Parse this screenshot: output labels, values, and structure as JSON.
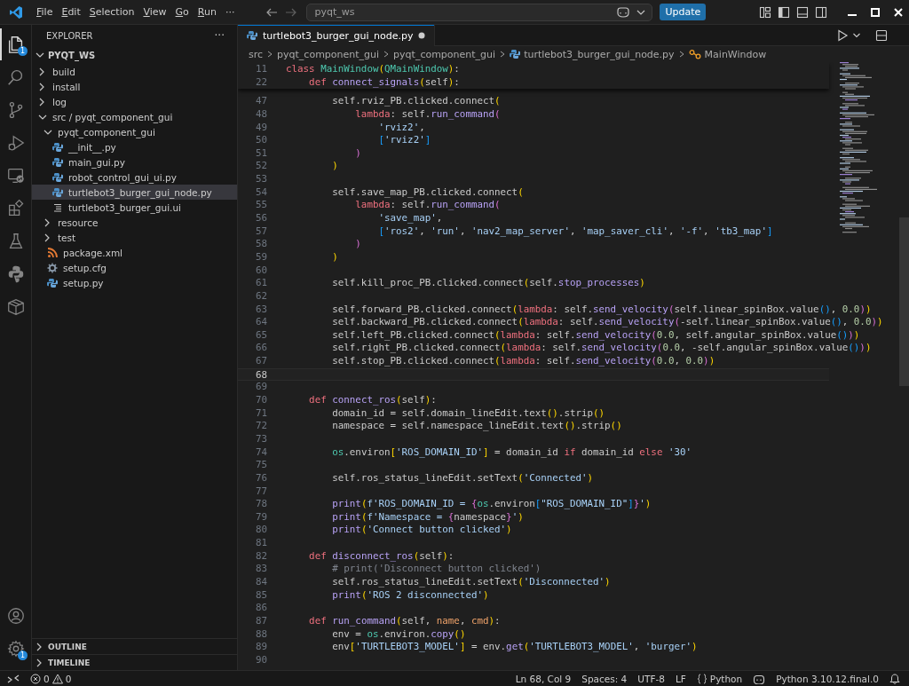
{
  "title_bar": {
    "menus": [
      "File",
      "Edit",
      "Selection",
      "View",
      "Go",
      "Run"
    ],
    "more": "···",
    "search": {
      "value": "pyqt_ws"
    },
    "update_button": "Update"
  },
  "activity_bar": {
    "items": [
      {
        "kind": "explorer",
        "selected": true,
        "badge": "1"
      },
      {
        "kind": "search",
        "selected": false
      },
      {
        "kind": "source-control",
        "selected": false
      },
      {
        "kind": "debug",
        "selected": false
      },
      {
        "kind": "remote",
        "selected": false
      },
      {
        "kind": "extensions",
        "selected": false
      },
      {
        "kind": "testing",
        "selected": false
      },
      {
        "kind": "python",
        "selected": false
      },
      {
        "kind": "package",
        "selected": false
      }
    ],
    "bottom": [
      {
        "kind": "account"
      },
      {
        "kind": "settings",
        "badge": "1"
      }
    ]
  },
  "sidebar": {
    "title": "EXPLORER",
    "more": "···",
    "root": {
      "label": "PYQT_WS",
      "expanded": true
    },
    "tree": [
      {
        "label": "build",
        "kind": "folder",
        "expanded": false,
        "selected": false
      },
      {
        "label": "install",
        "kind": "folder",
        "expanded": false,
        "selected": false
      },
      {
        "label": "log",
        "kind": "folder",
        "expanded": false,
        "selected": false
      },
      {
        "label": "src / pyqt_component_gui",
        "kind": "folder",
        "expanded": true,
        "selected": false,
        "children": [
          {
            "label": "pyqt_component_gui",
            "kind": "folder",
            "expanded": true,
            "selected": false,
            "children": [
              {
                "label": "__init__.py",
                "kind": "python",
                "selected": false
              },
              {
                "label": "main_gui.py",
                "kind": "python",
                "selected": false
              },
              {
                "label": "robot_control_gui_ui.py",
                "kind": "python",
                "selected": false
              },
              {
                "label": "turtlebot3_burger_gui_node.py",
                "kind": "python",
                "selected": true
              },
              {
                "label": "turtlebot3_burger_gui.ui",
                "kind": "text",
                "selected": false
              }
            ]
          },
          {
            "label": "resource",
            "kind": "folder",
            "expanded": false,
            "selected": false
          },
          {
            "label": "test",
            "kind": "folder",
            "expanded": false,
            "selected": false
          },
          {
            "label": "package.xml",
            "kind": "feed",
            "selected": false
          },
          {
            "label": "setup.cfg",
            "kind": "config",
            "selected": false
          },
          {
            "label": "setup.py",
            "kind": "python",
            "selected": false
          }
        ]
      }
    ],
    "sections": [
      {
        "label": "OUTLINE",
        "expanded": false
      },
      {
        "label": "TIMELINE",
        "expanded": false
      }
    ]
  },
  "editor": {
    "tabs": [
      {
        "label": "turtlebot3_burger_gui_node.py",
        "selected": true,
        "modified": true
      }
    ],
    "breadcrumbs": [
      {
        "text": "src",
        "kind": "folder"
      },
      {
        "text": "pyqt_component_gui",
        "kind": "folder"
      },
      {
        "text": "pyqt_component_gui",
        "kind": "folder"
      },
      {
        "text": "turtlebot3_burger_gui_node.py",
        "kind": "python"
      },
      {
        "text": "MainWindow",
        "kind": "class"
      }
    ],
    "sticky": [
      {
        "number": "11",
        "tokens": [
          {
            "kind": "keyword",
            "text": "class "
          },
          {
            "kind": "class",
            "text": "MainWindow"
          },
          {
            "kind": "brace1",
            "text": "("
          },
          {
            "kind": "class",
            "text": "QMainWindow"
          },
          {
            "kind": "brace1",
            "text": ")"
          },
          {
            "kind": "plain",
            "text": ":"
          }
        ]
      },
      {
        "number": "22",
        "tokens": [
          {
            "kind": "keyword",
            "text": "    def "
          },
          {
            "kind": "function",
            "text": "connect_signals"
          },
          {
            "kind": "brace1",
            "text": "("
          },
          {
            "kind": "plain",
            "text": "self"
          },
          {
            "kind": "brace1",
            "text": ")"
          },
          {
            "kind": "plain",
            "text": ":"
          }
        ]
      }
    ],
    "lines": [
      {
        "number": "47",
        "current": false,
        "tokens": [
          {
            "kind": "plain",
            "text": "        self.rviz_PB.clicked.connect"
          },
          {
            "kind": "brace1",
            "text": "("
          }
        ]
      },
      {
        "number": "48",
        "current": false,
        "tokens": [
          {
            "kind": "keyword",
            "text": "            lambda"
          },
          {
            "kind": "plain",
            "text": ": self."
          },
          {
            "kind": "function",
            "text": "run_command"
          },
          {
            "kind": "brace2",
            "text": "("
          }
        ]
      },
      {
        "number": "49",
        "current": false,
        "tokens": [
          {
            "kind": "string",
            "text": "                'rviz2'"
          },
          {
            "kind": "plain",
            "text": ","
          }
        ]
      },
      {
        "number": "50",
        "current": false,
        "tokens": [
          {
            "kind": "brace3",
            "text": "                ["
          },
          {
            "kind": "string",
            "text": "'rviz2'"
          },
          {
            "kind": "brace3",
            "text": "]"
          }
        ]
      },
      {
        "number": "51",
        "current": false,
        "tokens": [
          {
            "kind": "brace2",
            "text": "            )"
          }
        ]
      },
      {
        "number": "52",
        "current": false,
        "tokens": [
          {
            "kind": "brace1",
            "text": "        )"
          }
        ]
      },
      {
        "number": "53",
        "current": false
      },
      {
        "number": "54",
        "current": false,
        "tokens": [
          {
            "kind": "plain",
            "text": "        self.save_map_PB.clicked.connect"
          },
          {
            "kind": "brace1",
            "text": "("
          }
        ]
      },
      {
        "number": "55",
        "current": false,
        "tokens": [
          {
            "kind": "keyword",
            "text": "            lambda"
          },
          {
            "kind": "plain",
            "text": ": self."
          },
          {
            "kind": "function",
            "text": "run_command"
          },
          {
            "kind": "brace2",
            "text": "("
          }
        ]
      },
      {
        "number": "56",
        "current": false,
        "tokens": [
          {
            "kind": "string",
            "text": "                'save_map'"
          },
          {
            "kind": "plain",
            "text": ","
          }
        ]
      },
      {
        "number": "57",
        "current": false,
        "tokens": [
          {
            "kind": "brace3",
            "text": "                ["
          },
          {
            "kind": "string",
            "text": "'ros2'"
          },
          {
            "kind": "plain",
            "text": ", "
          },
          {
            "kind": "string",
            "text": "'run'"
          },
          {
            "kind": "plain",
            "text": ", "
          },
          {
            "kind": "string",
            "text": "'nav2_map_server'"
          },
          {
            "kind": "plain",
            "text": ", "
          },
          {
            "kind": "string",
            "text": "'map_saver_cli'"
          },
          {
            "kind": "plain",
            "text": ", "
          },
          {
            "kind": "string",
            "text": "'-f'"
          },
          {
            "kind": "plain",
            "text": ", "
          },
          {
            "kind": "string",
            "text": "'tb3_map'"
          },
          {
            "kind": "brace3",
            "text": "]"
          }
        ]
      },
      {
        "number": "58",
        "current": false,
        "tokens": [
          {
            "kind": "brace2",
            "text": "            )"
          }
        ]
      },
      {
        "number": "59",
        "current": false,
        "tokens": [
          {
            "kind": "brace1",
            "text": "        )"
          }
        ]
      },
      {
        "number": "60",
        "current": false
      },
      {
        "number": "61",
        "current": false,
        "tokens": [
          {
            "kind": "plain",
            "text": "        self.kill_proc_PB.clicked.connect"
          },
          {
            "kind": "brace1",
            "text": "("
          },
          {
            "kind": "plain",
            "text": "self."
          },
          {
            "kind": "function",
            "text": "stop_processes"
          },
          {
            "kind": "brace1",
            "text": ")"
          }
        ]
      },
      {
        "number": "62",
        "current": false
      },
      {
        "number": "63",
        "current": false,
        "tokens": [
          {
            "kind": "plain",
            "text": "        self.forward_PB.clicked.connect"
          },
          {
            "kind": "brace1",
            "text": "("
          },
          {
            "kind": "keyword",
            "text": "lambda"
          },
          {
            "kind": "plain",
            "text": ": self."
          },
          {
            "kind": "function",
            "text": "send_velocity"
          },
          {
            "kind": "brace2",
            "text": "("
          },
          {
            "kind": "plain",
            "text": "self.linear_spinBox.value"
          },
          {
            "kind": "brace3",
            "text": "()"
          },
          {
            "kind": "plain",
            "text": ", "
          },
          {
            "kind": "number",
            "text": "0.0"
          },
          {
            "kind": "brace2",
            "text": ")"
          },
          {
            "kind": "brace1",
            "text": ")"
          }
        ]
      },
      {
        "number": "64",
        "current": false,
        "tokens": [
          {
            "kind": "plain",
            "text": "        self.backward_PB.clicked.connect"
          },
          {
            "kind": "brace1",
            "text": "("
          },
          {
            "kind": "keyword",
            "text": "lambda"
          },
          {
            "kind": "plain",
            "text": ": self."
          },
          {
            "kind": "function",
            "text": "send_velocity"
          },
          {
            "kind": "brace2",
            "text": "("
          },
          {
            "kind": "plain",
            "text": "-self.linear_spinBox.value"
          },
          {
            "kind": "brace3",
            "text": "()"
          },
          {
            "kind": "plain",
            "text": ", "
          },
          {
            "kind": "number",
            "text": "0.0"
          },
          {
            "kind": "brace2",
            "text": ")"
          },
          {
            "kind": "brace1",
            "text": ")"
          }
        ]
      },
      {
        "number": "65",
        "current": false,
        "tokens": [
          {
            "kind": "plain",
            "text": "        self.left_PB.clicked.connect"
          },
          {
            "kind": "brace1",
            "text": "("
          },
          {
            "kind": "keyword",
            "text": "lambda"
          },
          {
            "kind": "plain",
            "text": ": self."
          },
          {
            "kind": "function",
            "text": "send_velocity"
          },
          {
            "kind": "brace2",
            "text": "("
          },
          {
            "kind": "number",
            "text": "0.0"
          },
          {
            "kind": "plain",
            "text": ", self.angular_spinBox.value"
          },
          {
            "kind": "brace3",
            "text": "()"
          },
          {
            "kind": "brace2",
            "text": ")"
          },
          {
            "kind": "brace1",
            "text": ")"
          }
        ]
      },
      {
        "number": "66",
        "current": false,
        "tokens": [
          {
            "kind": "plain",
            "text": "        self.right_PB.clicked.connect"
          },
          {
            "kind": "brace1",
            "text": "("
          },
          {
            "kind": "keyword",
            "text": "lambda"
          },
          {
            "kind": "plain",
            "text": ": self."
          },
          {
            "kind": "function",
            "text": "send_velocity"
          },
          {
            "kind": "brace2",
            "text": "("
          },
          {
            "kind": "number",
            "text": "0.0"
          },
          {
            "kind": "plain",
            "text": ", -self.angular_spinBox.value"
          },
          {
            "kind": "brace3",
            "text": "()"
          },
          {
            "kind": "brace2",
            "text": ")"
          },
          {
            "kind": "brace1",
            "text": ")"
          }
        ]
      },
      {
        "number": "67",
        "current": false,
        "tokens": [
          {
            "kind": "plain",
            "text": "        self.stop_PB.clicked.connect"
          },
          {
            "kind": "brace1",
            "text": "("
          },
          {
            "kind": "keyword",
            "text": "lambda"
          },
          {
            "kind": "plain",
            "text": ": self."
          },
          {
            "kind": "function",
            "text": "send_velocity"
          },
          {
            "kind": "brace2",
            "text": "("
          },
          {
            "kind": "number",
            "text": "0.0"
          },
          {
            "kind": "plain",
            "text": ", "
          },
          {
            "kind": "number",
            "text": "0.0"
          },
          {
            "kind": "brace2",
            "text": ")"
          },
          {
            "kind": "brace1",
            "text": ")"
          }
        ]
      },
      {
        "number": "68",
        "current": true
      },
      {
        "number": "69",
        "current": false
      },
      {
        "number": "70",
        "current": false,
        "tokens": [
          {
            "kind": "keyword",
            "text": "    def "
          },
          {
            "kind": "function",
            "text": "connect_ros"
          },
          {
            "kind": "brace1",
            "text": "("
          },
          {
            "kind": "plain",
            "text": "self"
          },
          {
            "kind": "brace1",
            "text": ")"
          },
          {
            "kind": "plain",
            "text": ":"
          }
        ]
      },
      {
        "number": "71",
        "current": false,
        "tokens": [
          {
            "kind": "plain",
            "text": "        domain_id = self.domain_lineEdit.text"
          },
          {
            "kind": "brace1",
            "text": "()"
          },
          {
            "kind": "plain",
            "text": ".strip"
          },
          {
            "kind": "brace1",
            "text": "()"
          }
        ]
      },
      {
        "number": "72",
        "current": false,
        "tokens": [
          {
            "kind": "plain",
            "text": "        namespace = self.namespace_lineEdit.text"
          },
          {
            "kind": "brace1",
            "text": "()"
          },
          {
            "kind": "plain",
            "text": ".strip"
          },
          {
            "kind": "brace1",
            "text": "()"
          }
        ]
      },
      {
        "number": "73",
        "current": false
      },
      {
        "number": "74",
        "current": false,
        "tokens": [
          {
            "kind": "module",
            "text": "        os"
          },
          {
            "kind": "plain",
            "text": ".environ"
          },
          {
            "kind": "brace1",
            "text": "["
          },
          {
            "kind": "string",
            "text": "'ROS_DOMAIN_ID'"
          },
          {
            "kind": "brace1",
            "text": "]"
          },
          {
            "kind": "plain",
            "text": " = domain_id "
          },
          {
            "kind": "keyword",
            "text": "if"
          },
          {
            "kind": "plain",
            "text": " domain_id "
          },
          {
            "kind": "keyword",
            "text": "else"
          },
          {
            "kind": "string",
            "text": " '30'"
          }
        ]
      },
      {
        "number": "75",
        "current": false
      },
      {
        "number": "76",
        "current": false,
        "tokens": [
          {
            "kind": "plain",
            "text": "        self.ros_status_lineEdit.setText"
          },
          {
            "kind": "brace1",
            "text": "("
          },
          {
            "kind": "string",
            "text": "'Connected'"
          },
          {
            "kind": "brace1",
            "text": ")"
          }
        ]
      },
      {
        "number": "77",
        "current": false
      },
      {
        "number": "78",
        "current": false,
        "tokens": [
          {
            "kind": "function",
            "text": "        print"
          },
          {
            "kind": "brace1",
            "text": "("
          },
          {
            "kind": "string",
            "text": "f'ROS_DOMAIN_ID = "
          },
          {
            "kind": "brace2",
            "text": "{"
          },
          {
            "kind": "module",
            "text": "os"
          },
          {
            "kind": "plain",
            "text": ".environ"
          },
          {
            "kind": "brace3",
            "text": "["
          },
          {
            "kind": "string",
            "text": "\"ROS_DOMAIN_ID\""
          },
          {
            "kind": "brace3",
            "text": "]"
          },
          {
            "kind": "brace2",
            "text": "}"
          },
          {
            "kind": "string",
            "text": "'"
          },
          {
            "kind": "brace1",
            "text": ")"
          }
        ]
      },
      {
        "number": "79",
        "current": false,
        "tokens": [
          {
            "kind": "function",
            "text": "        print"
          },
          {
            "kind": "brace1",
            "text": "("
          },
          {
            "kind": "string",
            "text": "f'Namespace = "
          },
          {
            "kind": "brace2",
            "text": "{"
          },
          {
            "kind": "plain",
            "text": "namespace"
          },
          {
            "kind": "brace2",
            "text": "}"
          },
          {
            "kind": "string",
            "text": "'"
          },
          {
            "kind": "brace1",
            "text": ")"
          }
        ]
      },
      {
        "number": "80",
        "current": false,
        "tokens": [
          {
            "kind": "function",
            "text": "        print"
          },
          {
            "kind": "brace1",
            "text": "("
          },
          {
            "kind": "string",
            "text": "'Connect button clicked'"
          },
          {
            "kind": "brace1",
            "text": ")"
          }
        ]
      },
      {
        "number": "81",
        "current": false
      },
      {
        "number": "82",
        "current": false,
        "tokens": [
          {
            "kind": "keyword",
            "text": "    def "
          },
          {
            "kind": "function",
            "text": "disconnect_ros"
          },
          {
            "kind": "brace1",
            "text": "("
          },
          {
            "kind": "plain",
            "text": "self"
          },
          {
            "kind": "brace1",
            "text": ")"
          },
          {
            "kind": "plain",
            "text": ":"
          }
        ]
      },
      {
        "number": "83",
        "current": false,
        "tokens": [
          {
            "kind": "comment",
            "text": "        # print('Disconnect button clicked')"
          }
        ]
      },
      {
        "number": "84",
        "current": false,
        "tokens": [
          {
            "kind": "plain",
            "text": "        self.ros_status_lineEdit.setText"
          },
          {
            "kind": "brace1",
            "text": "("
          },
          {
            "kind": "string",
            "text": "'Disconnected'"
          },
          {
            "kind": "brace1",
            "text": ")"
          }
        ]
      },
      {
        "number": "85",
        "current": false,
        "tokens": [
          {
            "kind": "function",
            "text": "        print"
          },
          {
            "kind": "brace1",
            "text": "("
          },
          {
            "kind": "string",
            "text": "'ROS 2 disconnected'"
          },
          {
            "kind": "brace1",
            "text": ")"
          }
        ]
      },
      {
        "number": "86",
        "current": false
      },
      {
        "number": "87",
        "current": false,
        "tokens": [
          {
            "kind": "keyword",
            "text": "    def "
          },
          {
            "kind": "function",
            "text": "run_command"
          },
          {
            "kind": "brace1",
            "text": "("
          },
          {
            "kind": "plain",
            "text": "self, "
          },
          {
            "kind": "param",
            "text": "name"
          },
          {
            "kind": "plain",
            "text": ", "
          },
          {
            "kind": "param",
            "text": "cmd"
          },
          {
            "kind": "brace1",
            "text": ")"
          },
          {
            "kind": "plain",
            "text": ":"
          }
        ]
      },
      {
        "number": "88",
        "current": false,
        "tokens": [
          {
            "kind": "plain",
            "text": "        env = "
          },
          {
            "kind": "module",
            "text": "os"
          },
          {
            "kind": "plain",
            "text": ".environ."
          },
          {
            "kind": "function",
            "text": "copy"
          },
          {
            "kind": "brace1",
            "text": "()"
          }
        ]
      },
      {
        "number": "89",
        "current": false,
        "tokens": [
          {
            "kind": "plain",
            "text": "        env"
          },
          {
            "kind": "brace1",
            "text": "["
          },
          {
            "kind": "string",
            "text": "'TURTLEBOT3_MODEL'"
          },
          {
            "kind": "brace1",
            "text": "]"
          },
          {
            "kind": "plain",
            "text": " = env."
          },
          {
            "kind": "function",
            "text": "get"
          },
          {
            "kind": "brace1",
            "text": "("
          },
          {
            "kind": "string",
            "text": "'TURTLEBOT3_MODEL'"
          },
          {
            "kind": "plain",
            "text": ", "
          },
          {
            "kind": "string",
            "text": "'burger'"
          },
          {
            "kind": "brace1",
            "text": ")"
          }
        ]
      },
      {
        "number": "90",
        "current": false
      }
    ]
  },
  "status_bar": {
    "errors": "0",
    "warnings": "0",
    "items": [
      {
        "kind": "text",
        "text": "Ln 68, Col 9"
      },
      {
        "kind": "text",
        "text": "Spaces: 4"
      },
      {
        "kind": "text",
        "text": "UTF-8"
      },
      {
        "kind": "text",
        "text": "LF"
      },
      {
        "kind": "language",
        "text": "Python"
      },
      {
        "kind": "copilot"
      },
      {
        "kind": "text",
        "text": "Python 3.10.12.final.0"
      },
      {
        "kind": "notifications"
      }
    ]
  }
}
